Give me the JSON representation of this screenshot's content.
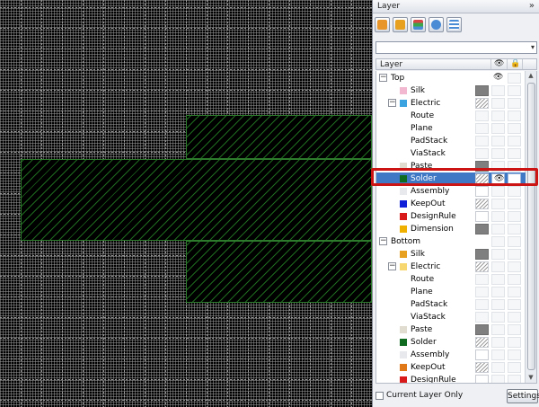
{
  "panel": {
    "title": "Layer",
    "collapse_glyph": "»",
    "toolbar": [
      {
        "icon": "file-icon",
        "color": "#e8962a"
      },
      {
        "icon": "layers-stack-icon",
        "color": "#e8a020"
      },
      {
        "icon": "3d-layers-icon",
        "color": "#d94545"
      },
      {
        "icon": "key-icon",
        "color": "#4a8bd6"
      },
      {
        "icon": "layer-table-icon",
        "color": "#4a8bd6"
      }
    ],
    "combo_value": "",
    "header": {
      "layer_label": "Layer",
      "visible_glyph": "👁",
      "lock_glyph": "🔒"
    },
    "eye_glyph": "👁",
    "footer": {
      "current_layer_only": "Current Layer Only",
      "settings": "Settings"
    }
  },
  "tree": [
    {
      "label": "Top",
      "level": 0,
      "expander": "−",
      "swatch": null,
      "vis": "eye",
      "cell1": null
    },
    {
      "label": "Silk",
      "level": 2,
      "swatch": "#f2b8d0",
      "cell1": "dark"
    },
    {
      "label": "Electric",
      "level": 1,
      "expander": "−",
      "swatch": "#3aa3e0",
      "cell1": "hatch"
    },
    {
      "label": "Route",
      "level": 2,
      "swatch": null,
      "cell1": "ghost"
    },
    {
      "label": "Plane",
      "level": 2,
      "swatch": null,
      "cell1": "ghost"
    },
    {
      "label": "PadStack",
      "level": 2,
      "swatch": null,
      "cell1": "ghost"
    },
    {
      "label": "ViaStack",
      "level": 2,
      "swatch": null,
      "cell1": "ghost"
    },
    {
      "label": "Paste",
      "level": 2,
      "swatch": "#e0dccf",
      "cell1": "dark"
    },
    {
      "label": "Solder",
      "level": 2,
      "swatch": "#0f6b1f",
      "cell1": "hatch",
      "selected": true,
      "vis": "eye"
    },
    {
      "label": "Assembly",
      "level": 2,
      "swatch": "#e7e9ec",
      "cell1": "white"
    },
    {
      "label": "KeepOut",
      "level": 2,
      "swatch": "#1020d8",
      "cell1": "hatch"
    },
    {
      "label": "DesignRule",
      "level": 2,
      "swatch": "#d81a1a",
      "cell1": "white"
    },
    {
      "label": "Dimension",
      "level": 2,
      "swatch": "#f0b000",
      "cell1": "dark"
    },
    {
      "label": "Bottom",
      "level": 0,
      "expander": "−",
      "swatch": null,
      "cell1": null
    },
    {
      "label": "Silk",
      "level": 2,
      "swatch": "#e8a020",
      "cell1": "dark"
    },
    {
      "label": "Electric",
      "level": 1,
      "expander": "−",
      "swatch": "#f6d770",
      "cell1": "hatch"
    },
    {
      "label": "Route",
      "level": 2,
      "swatch": null,
      "cell1": "ghost"
    },
    {
      "label": "Plane",
      "level": 2,
      "swatch": null,
      "cell1": "ghost"
    },
    {
      "label": "PadStack",
      "level": 2,
      "swatch": null,
      "cell1": "ghost"
    },
    {
      "label": "ViaStack",
      "level": 2,
      "swatch": null,
      "cell1": "ghost"
    },
    {
      "label": "Paste",
      "level": 2,
      "swatch": "#e0dccf",
      "cell1": "dark"
    },
    {
      "label": "Solder",
      "level": 2,
      "swatch": "#0f6b1f",
      "cell1": "hatch"
    },
    {
      "label": "Assembly",
      "level": 2,
      "swatch": "#e7e9ec",
      "cell1": "white"
    },
    {
      "label": "KeepOut",
      "level": 2,
      "swatch": "#e07818",
      "cell1": "hatch"
    },
    {
      "label": "DesignRule",
      "level": 2,
      "swatch": "#d81a1a",
      "cell1": "white"
    }
  ],
  "colors": {
    "hatch": "#1f6b1f",
    "selection": "#3f78c5",
    "highlight": "#cc1414"
  }
}
